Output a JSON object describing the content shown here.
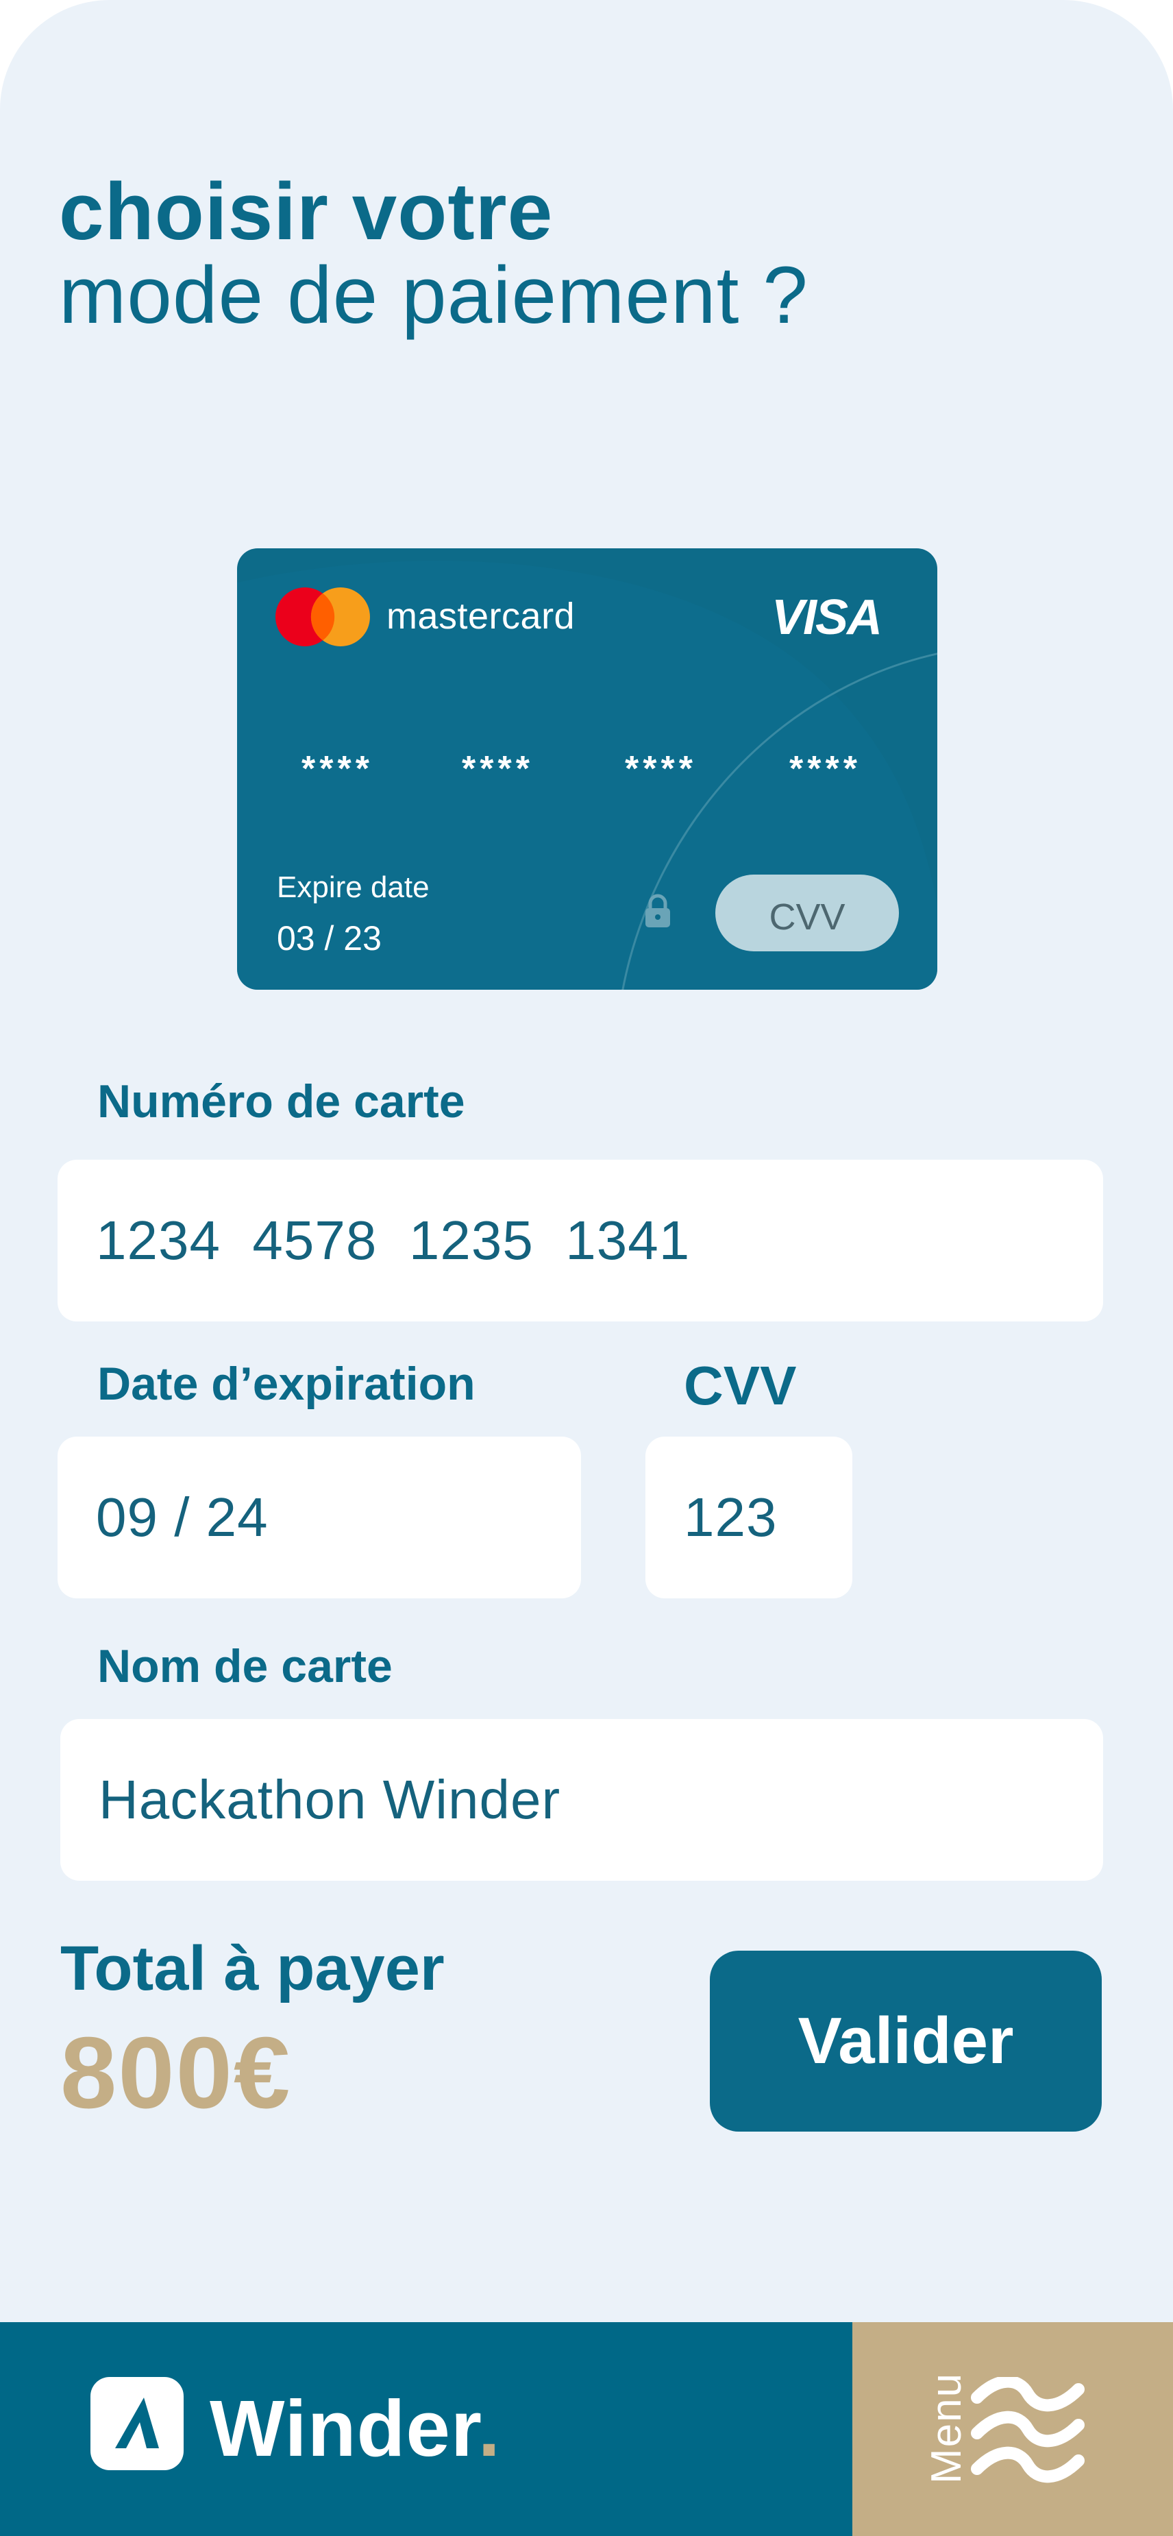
{
  "title": {
    "line1": "choisir votre",
    "line2": "mode de paiement ?"
  },
  "card": {
    "brand_name": "mastercard",
    "network": "VISA",
    "masked_groups": [
      "****",
      "****",
      "****",
      "****"
    ],
    "expire_label": "Expire date",
    "expire_value": "03 / 23",
    "cvv_label": "CVV",
    "background_color": "#0d6b89"
  },
  "form": {
    "card_number_label": "Numéro de carte",
    "card_number_value": "1234  4578  1235  1341",
    "expiration_label": "Date d’expiration",
    "expiration_value": "09 / 24",
    "cvv_label": "CVV",
    "cvv_value": "123",
    "card_name_label": "Nom de carte",
    "card_name_value": "Hackathon Winder"
  },
  "total": {
    "label": "Total à payer",
    "amount": "800€"
  },
  "actions": {
    "validate_label": "Valider"
  },
  "footer": {
    "brand": "Winder",
    "brand_dot": ".",
    "menu_label": "Menu",
    "logo_icon": "winder-logo-icon",
    "menu_icon": "waves-menu-icon"
  },
  "colors": {
    "primary": "#0b6a89",
    "accent_gold": "#c4ae86",
    "background": "#ebf2f9",
    "footer": "#006887"
  }
}
